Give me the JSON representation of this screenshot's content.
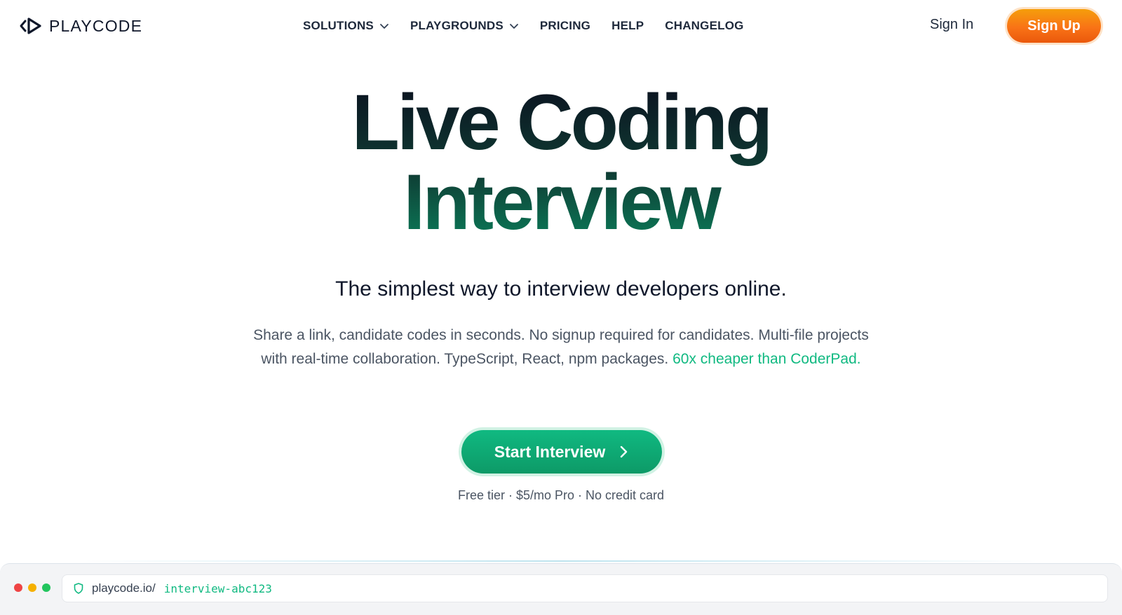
{
  "brand": {
    "name": "PLAYCODE"
  },
  "nav": {
    "items": [
      {
        "label": "SOLUTIONS",
        "has_dropdown": true
      },
      {
        "label": "PLAYGROUNDS",
        "has_dropdown": true
      },
      {
        "label": "PRICING",
        "has_dropdown": false
      },
      {
        "label": "HELP",
        "has_dropdown": false
      },
      {
        "label": "CHANGELOG",
        "has_dropdown": false
      }
    ],
    "sign_in": "Sign In",
    "sign_up": "Sign Up"
  },
  "hero": {
    "title_line1": "Live Coding",
    "title_line2": "Interview",
    "subtitle": "The simplest way to interview developers online.",
    "description": "Share a link, candidate codes in seconds. No signup required for candidates. Multi-file projects with real-time collaboration. TypeScript, React, npm packages.",
    "description_highlight": "60x cheaper than CoderPad.",
    "cta_label": "Start Interview",
    "cta_note": "Free tier · $5/mo Pro · No credit card"
  },
  "browser_preview": {
    "url_host": "playcode.io/",
    "url_path": "interview-abc123"
  },
  "icons": {
    "logo": "playcode-logo-icon",
    "dropdown": "chevron-down-icon",
    "cta_arrow": "chevron-right-icon",
    "secure": "shield-icon"
  },
  "colors": {
    "accent_green": "#10b981",
    "signup_orange": "#f97316",
    "window_red": "#ef4444",
    "window_yellow": "#f5b000",
    "window_green": "#22c55e"
  }
}
